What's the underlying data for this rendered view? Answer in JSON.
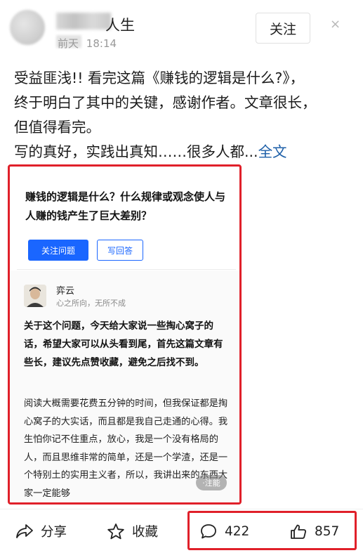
{
  "post": {
    "author_suffix": "人生",
    "time_prefix": "前天",
    "time": "18:14",
    "follow_label": "关注",
    "close_glyph": "×",
    "text_line1": "受益匪浅!! 看完这篇《赚钱的逻辑是什么?》，",
    "text_line2": "终于明白了其中的关键，感谢作者。文章很长，",
    "text_line3": "但值得看完。",
    "text_line4": "写的真好，实践出真知……很多人都...",
    "fulltext_link": "全文"
  },
  "card": {
    "question": "赚钱的逻辑是什么？什么规律或观念使人与人赚的钱产生了巨大差别？",
    "follow_question": "关注问题",
    "write_answer": "写回答",
    "answerer_name": "弈云",
    "answerer_bio": "心之所向，无所不成",
    "bold_paragraph": "关于这个问题，今天给大家说一些掏心窝子的话，希望大家可以从头看到尾，首先这篇文章有些长，建议先点赞收藏，避免之后找不到。",
    "body_paragraph": "阅读大概需要花费五分钟的时间，但我保证都是掏心窝子的大实话，而且都是我自己走通的心得。我生怕你记不住重点，放心，我是一个没有格局的人，而且思维非常的简单，还是一个学渣，还是一个特别土的实用主义者，所以，我讲出来的东西大家一定能够",
    "watermark": "·注能"
  },
  "actions": {
    "share": "分享",
    "favorite": "收藏",
    "comments": "422",
    "likes": "857"
  },
  "colors": {
    "accent_blue": "#1a66ff",
    "link_blue": "#1d5fa8",
    "highlight_red": "#e0202a"
  }
}
